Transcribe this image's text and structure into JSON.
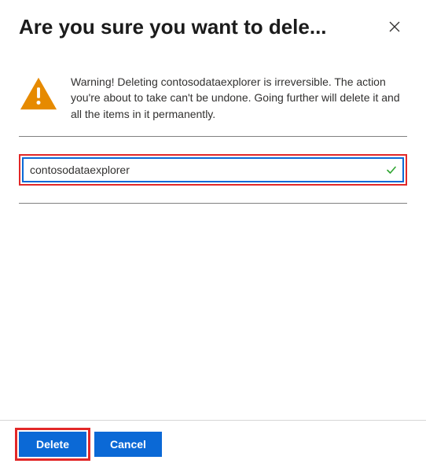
{
  "header": {
    "title": "Are you sure you want to dele..."
  },
  "warning": {
    "text": "Warning! Deleting contosodataexplorer is irreversible. The action you're about to take can't be undone. Going further will delete it and all the items in it permanently."
  },
  "input": {
    "value": "contosodataexplorer"
  },
  "buttons": {
    "delete": "Delete",
    "cancel": "Cancel"
  },
  "colors": {
    "accent": "#0b69d6",
    "warning": "#e68a00",
    "danger": "#e22828",
    "success": "#2fa531"
  }
}
